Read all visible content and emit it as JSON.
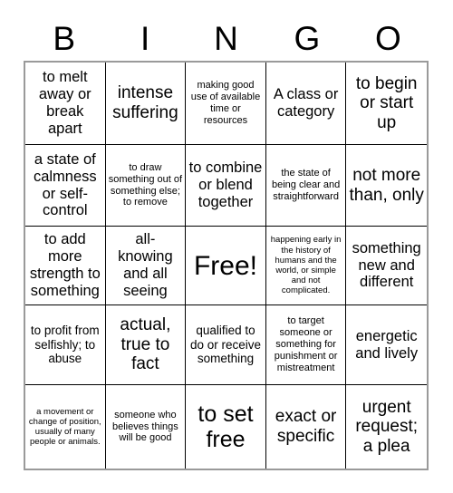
{
  "card": {
    "type": "bingo-card",
    "header_letters": [
      "B",
      "I",
      "N",
      "G",
      "O"
    ],
    "columns": 5,
    "rows": 5,
    "free_space_label": "Free!",
    "free_space_position": "center",
    "colors": {
      "background": "#ffffff",
      "text": "#000000",
      "cell_border": "#000000",
      "outer_border": "#9a9a9a"
    },
    "cells": [
      {
        "text": "to melt away or break apart",
        "size": "fs-l"
      },
      {
        "text": "intense suffering",
        "size": "fs-xl"
      },
      {
        "text": "making good use of available time or resources",
        "size": "fs-s"
      },
      {
        "text": "A class or category",
        "size": "fs-l"
      },
      {
        "text": "to begin or start up",
        "size": "fs-xl"
      },
      {
        "text": "a state of calmness or self-control",
        "size": "fs-l"
      },
      {
        "text": "to draw something out of something else; to remove",
        "size": "fs-s"
      },
      {
        "text": "to combine or blend together",
        "size": "fs-l"
      },
      {
        "text": "the state of being clear and straightforward",
        "size": "fs-s"
      },
      {
        "text": "not more than, only",
        "size": "fs-xl"
      },
      {
        "text": "to add more strength to something",
        "size": "fs-l"
      },
      {
        "text": "all-knowing and all seeing",
        "size": "fs-l"
      },
      {
        "text": "Free!",
        "size": "fs-free"
      },
      {
        "text": "happening early in the history of humans and the world, or simple and not complicated.",
        "size": "fs-xs"
      },
      {
        "text": "something new and different",
        "size": "fs-l"
      },
      {
        "text": "to profit from selfishly; to abuse",
        "size": "fs-m"
      },
      {
        "text": "actual, true to fact",
        "size": "fs-xl"
      },
      {
        "text": "qualified to do or receive something",
        "size": "fs-m"
      },
      {
        "text": "to target someone or something for punishment or mistreatment",
        "size": "fs-s"
      },
      {
        "text": "energetic and lively",
        "size": "fs-l"
      },
      {
        "text": "a movement or change of position, usually of many people or animals.",
        "size": "fs-xs"
      },
      {
        "text": "someone who believes things will be good",
        "size": "fs-s"
      },
      {
        "text": "to set free",
        "size": "fs-xxl"
      },
      {
        "text": "exact or specific",
        "size": "fs-xl"
      },
      {
        "text": "urgent request; a plea",
        "size": "fs-xl"
      }
    ]
  }
}
